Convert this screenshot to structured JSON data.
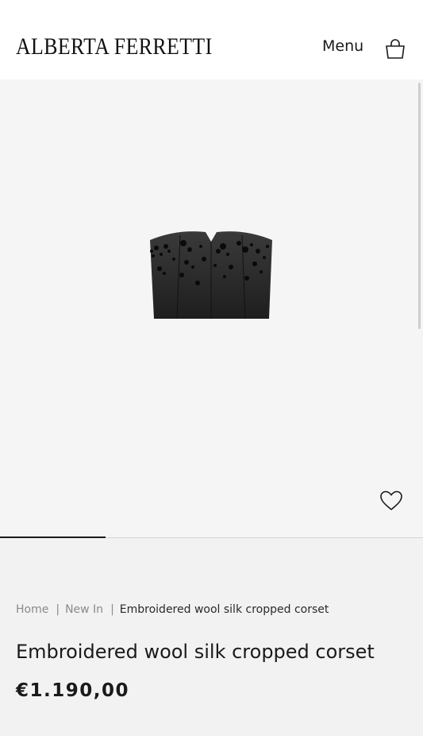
{
  "header": {
    "logo_text": "ALBERTA FERRETTI",
    "menu_label": "Menu",
    "bag_icon": "shopping-bag-icon"
  },
  "gallery": {
    "image_subject": "black embellished strapless cropped corset",
    "wishlist_icon": "heart-icon",
    "position": 1,
    "count": 4
  },
  "breadcrumb": {
    "items": [
      "Home",
      "New In",
      "Embroidered wool silk cropped corset"
    ],
    "separator": "|"
  },
  "product": {
    "title": "Embroidered wool silk cropped corset",
    "price": "€1.190,00"
  },
  "colors": {
    "header_bg": "#ffffff",
    "gallery_bg": "#f5f5f5",
    "page_bg": "#f2f2f2",
    "text": "#1a1a1a",
    "muted_text": "#8a8a8a"
  }
}
